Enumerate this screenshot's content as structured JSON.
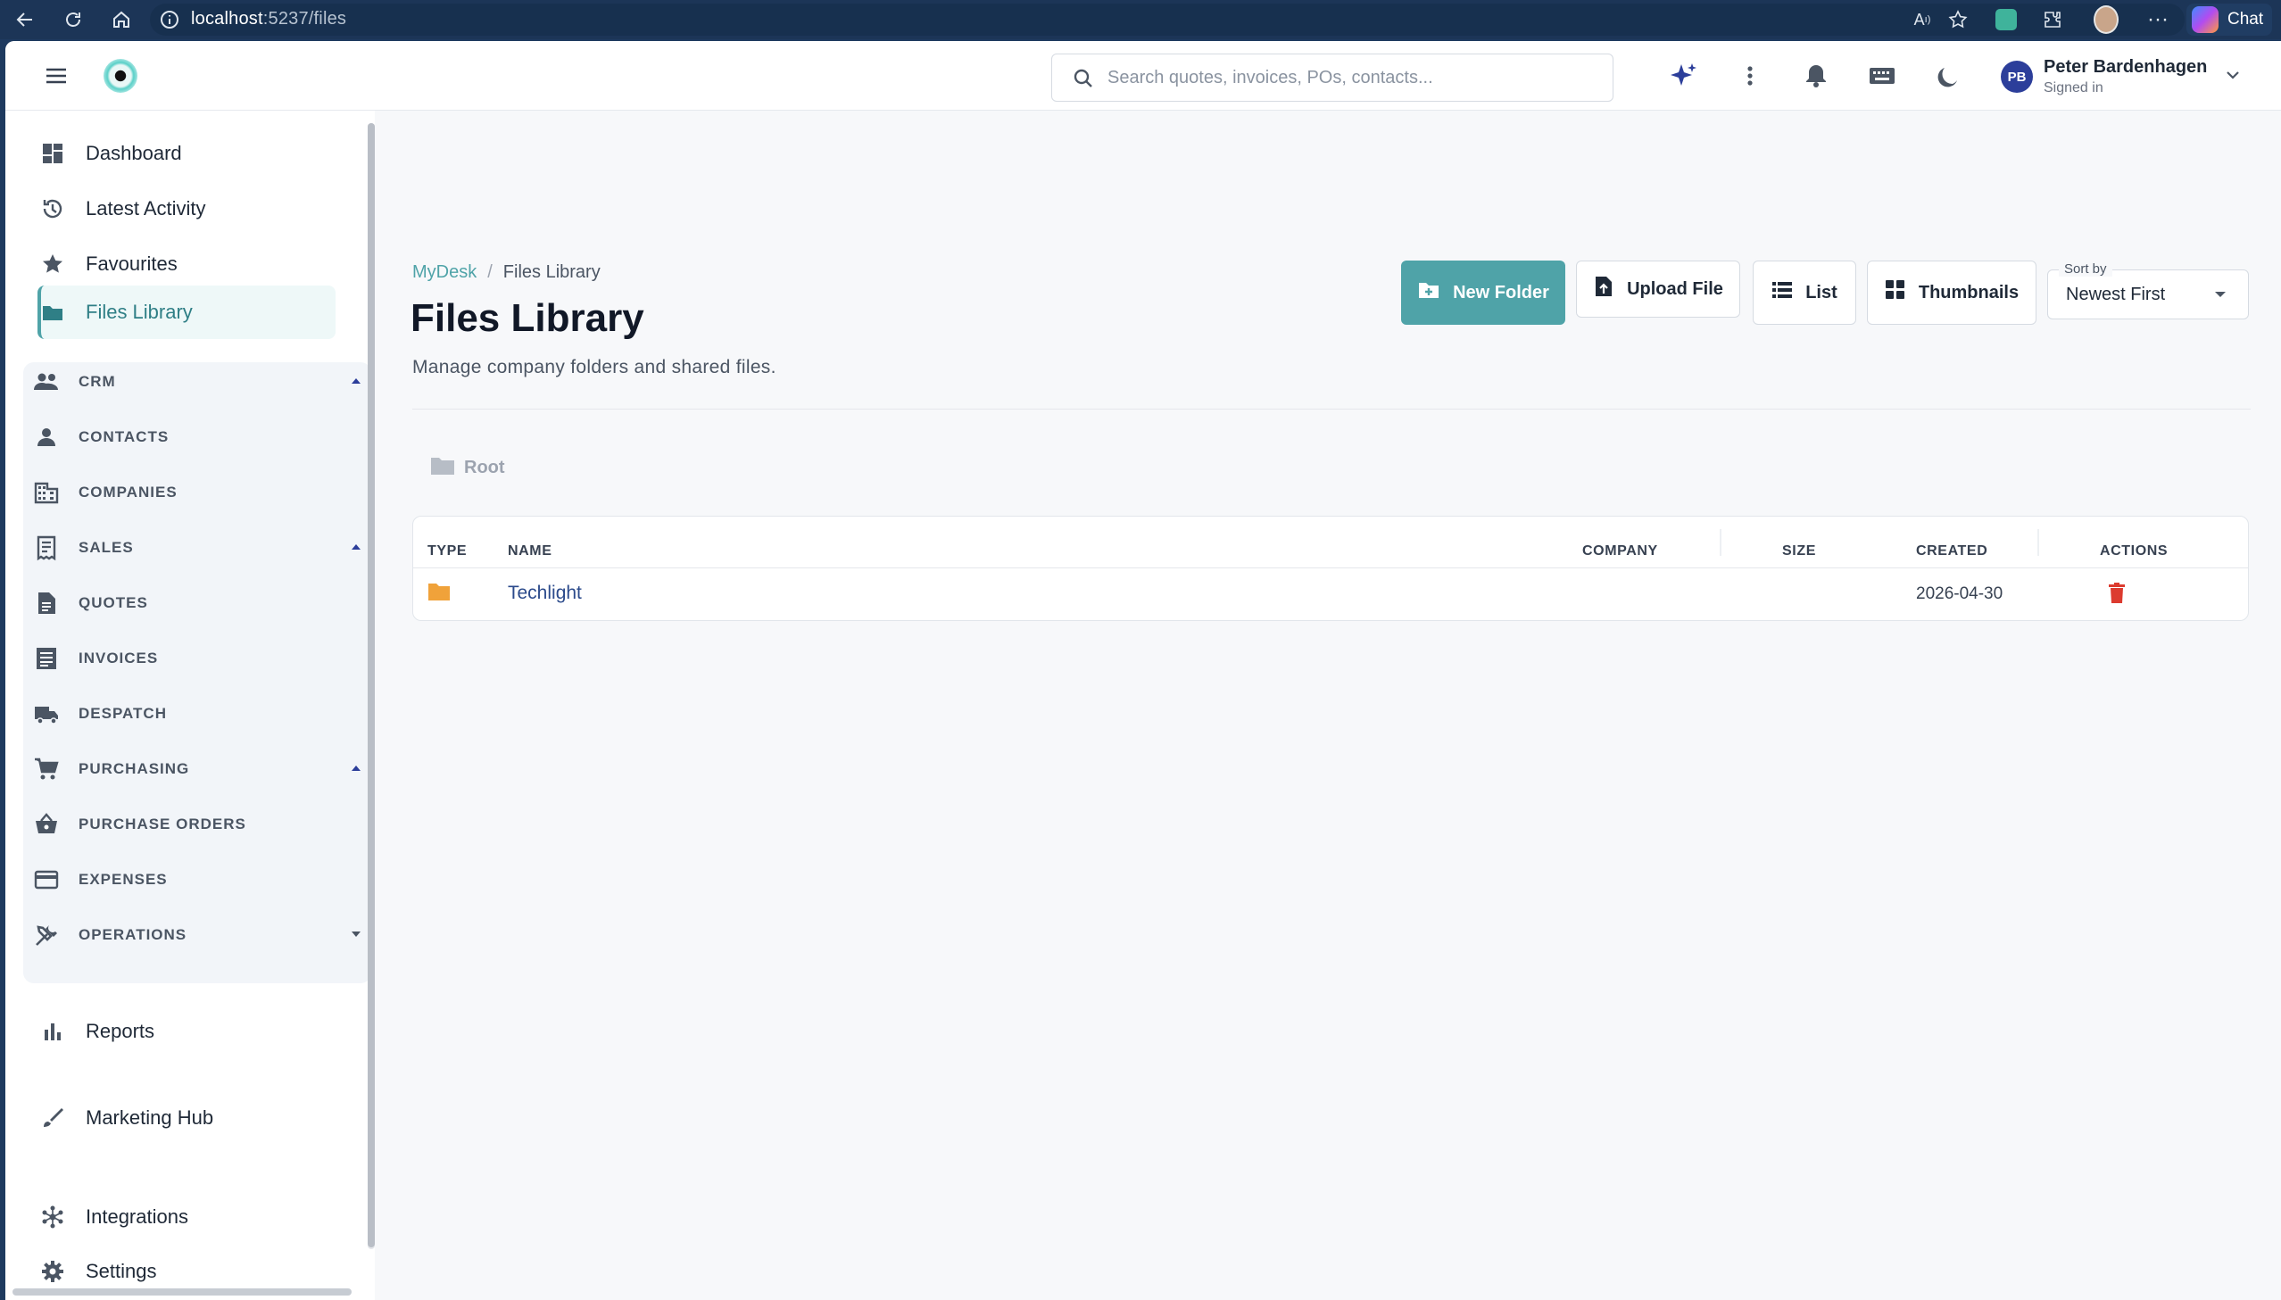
{
  "browser": {
    "url_host": "localhost",
    "url_path": ":5237/files",
    "chat_label": "Chat"
  },
  "topbar": {
    "search_placeholder": "Search quotes, invoices, POs, contacts...",
    "user_initials": "PB",
    "user_name": "Peter Bardenhagen",
    "user_status": "Signed in"
  },
  "sidebar": {
    "primary": [
      {
        "label": "Dashboard",
        "icon": "dashboard-icon"
      },
      {
        "label": "Latest Activity",
        "icon": "history-icon"
      },
      {
        "label": "Favourites",
        "icon": "star-icon"
      },
      {
        "label": "Files Library",
        "icon": "folder-icon",
        "active": true
      }
    ],
    "sections": [
      {
        "label": "CRM",
        "icon": "people-icon",
        "expanded": true
      },
      {
        "label": "CONTACTS",
        "icon": "person-icon"
      },
      {
        "label": "COMPANIES",
        "icon": "building-icon"
      },
      {
        "label": "SALES",
        "icon": "receipt-icon",
        "expanded": true
      },
      {
        "label": "QUOTES",
        "icon": "document-icon"
      },
      {
        "label": "INVOICES",
        "icon": "list-doc-icon"
      },
      {
        "label": "DESPATCH",
        "icon": "truck-icon"
      },
      {
        "label": "PURCHASING",
        "icon": "cart-icon",
        "expanded": true
      },
      {
        "label": "PURCHASE ORDERS",
        "icon": "basket-icon"
      },
      {
        "label": "EXPENSES",
        "icon": "card-icon"
      },
      {
        "label": "OPERATIONS",
        "icon": "tools-icon",
        "expanded": false
      }
    ],
    "bottom": [
      {
        "label": "Reports",
        "icon": "bar-chart-icon"
      },
      {
        "label": "Marketing Hub",
        "icon": "brush-icon"
      },
      {
        "label": "Integrations",
        "icon": "hub-icon"
      },
      {
        "label": "Settings",
        "icon": "gear-icon"
      }
    ]
  },
  "page": {
    "breadcrumb_root": "MyDesk",
    "breadcrumb_sep": "/",
    "breadcrumb_current": "Files Library",
    "title": "Files Library",
    "subtitle": "Manage company folders and shared files.",
    "new_folder_label": "New Folder",
    "upload_label": "Upload File",
    "list_label": "List",
    "thumbnails_label": "Thumbnails",
    "sort_label": "Sort by",
    "sort_value": "Newest First",
    "root_label": "Root"
  },
  "table": {
    "headers": [
      "TYPE",
      "NAME",
      "COMPANY",
      "SIZE",
      "CREATED",
      "ACTIONS"
    ],
    "rows": [
      {
        "type": "folder",
        "name": "Techlight",
        "company": "",
        "size": "",
        "created": "2026-04-30"
      }
    ]
  },
  "colors": {
    "accent": "#4fa3a8",
    "link": "#2b4a8b",
    "folder": "#f0a23a",
    "delete": "#dc3b2f"
  }
}
